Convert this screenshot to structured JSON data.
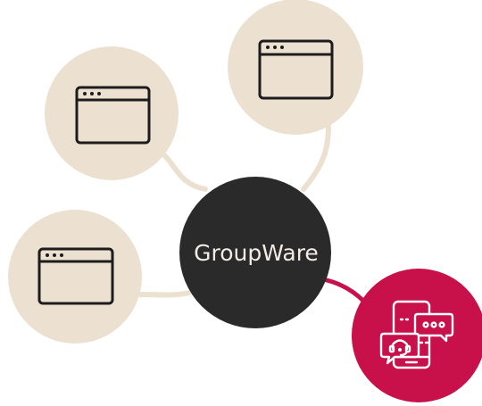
{
  "center": {
    "label": "GroupWare"
  },
  "nodes": [
    {
      "icon": "browser-window-icon"
    },
    {
      "icon": "browser-window-icon"
    },
    {
      "icon": "browser-window-icon"
    },
    {
      "icon": "customer-support-chat-icon"
    }
  ],
  "colors": {
    "hub": "#2a2a2a",
    "hub_text": "#f2ece4",
    "node_fill": "#ece0d0",
    "connector": "#ece0d0",
    "accent": "#c8104a",
    "icon_stroke": "#1c1c1c",
    "accent_icon_stroke": "#ffffff"
  }
}
